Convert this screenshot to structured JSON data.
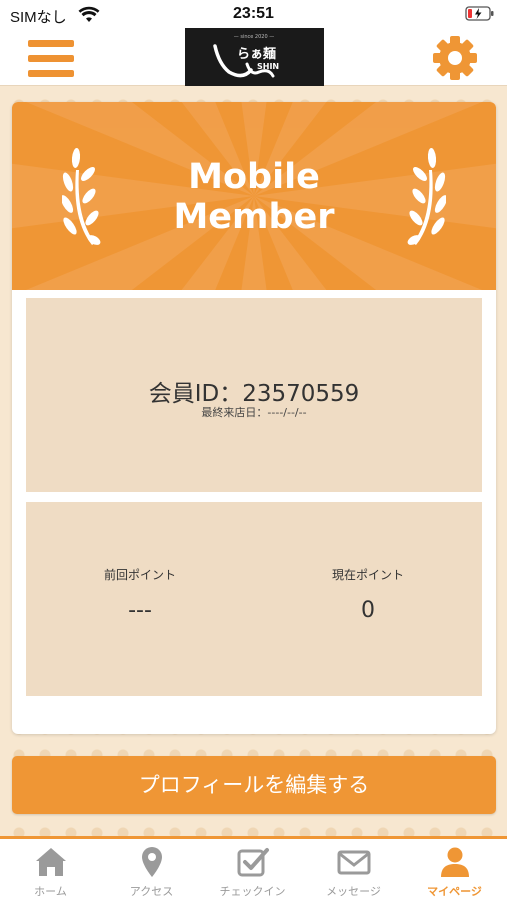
{
  "status_bar": {
    "carrier": "SIMなし",
    "time": "23:51"
  },
  "header": {
    "logo_alt": "らぁ麺 SHIN"
  },
  "member_card": {
    "banner_title_line1": "Mobile",
    "banner_title_line2": "Member",
    "member_id": "会員ID：23570559",
    "last_visit": "最終来店日：----/--/--",
    "points": {
      "previous_label": "前回ポイント",
      "previous_value": "---",
      "current_label": "現在ポイント",
      "current_value": "0"
    }
  },
  "edit_profile_label": "プロフィールを編集する",
  "tab_bar": {
    "tabs": [
      {
        "label": "ホーム",
        "icon": "home-icon"
      },
      {
        "label": "アクセス",
        "icon": "map-pin-icon"
      },
      {
        "label": "チェックイン",
        "icon": "checkbox-icon"
      },
      {
        "label": "メッセージ",
        "icon": "envelope-icon"
      },
      {
        "label": "マイページ",
        "icon": "user-icon"
      }
    ],
    "active_index": 4
  },
  "colors": {
    "accent": "#ef9635",
    "panel": "#efdcc4",
    "tab_inactive": "#9a9a9a"
  }
}
